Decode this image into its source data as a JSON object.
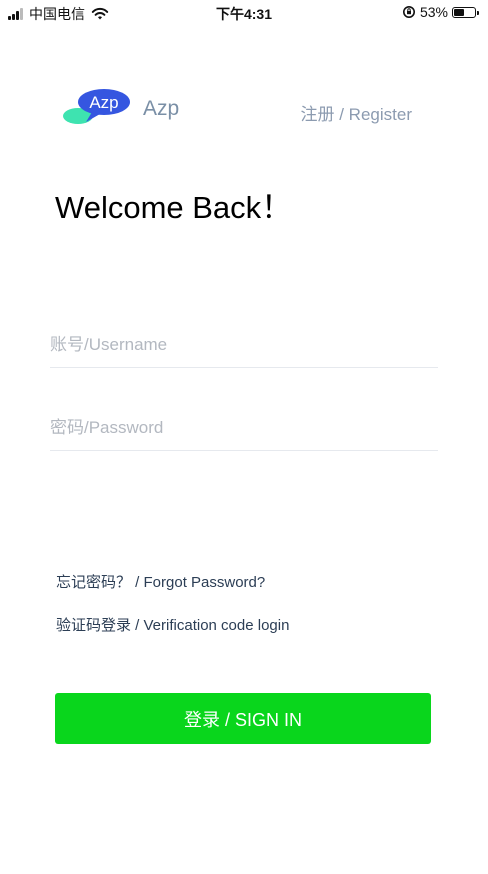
{
  "status_bar": {
    "carrier": "中国电信",
    "time": "下午4:31",
    "battery_percent": "53%",
    "battery_level": 0.53
  },
  "header": {
    "logo_text": "Azp",
    "app_name": "Azp",
    "register_label": "注册 / Register"
  },
  "main": {
    "welcome_title": "Welcome Back！",
    "username": {
      "value": "",
      "placeholder": "账号/Username"
    },
    "password": {
      "value": "",
      "placeholder": "密码/Password"
    },
    "forgot_password_label": "忘记密码？ / Forgot Password?",
    "verification_login_label": "验证码登录 / Verification code login",
    "sign_in_label": "登录 / SIGN IN"
  },
  "colors": {
    "primary_button": "#09d61c",
    "logo_bubble_blue": "#3556e0",
    "logo_bubble_teal": "#3ee3b0",
    "muted_text": "#8c9bb0"
  }
}
